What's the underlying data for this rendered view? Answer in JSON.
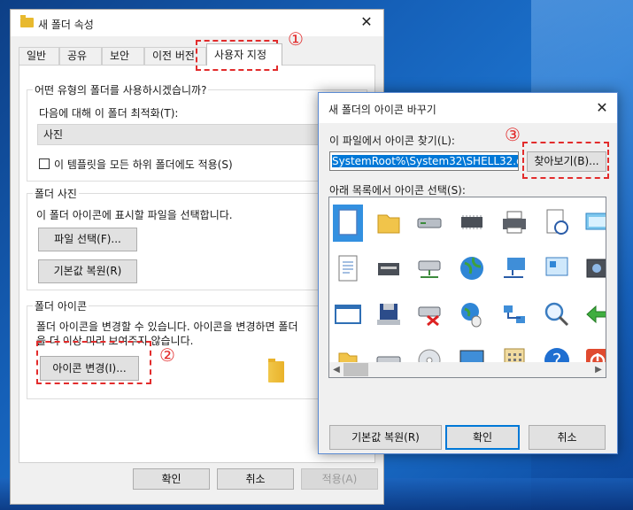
{
  "properties_window": {
    "title": "새 폴더 속성",
    "tabs": [
      "일반",
      "공유",
      "보안",
      "이전 버전",
      "사용자 지정"
    ],
    "active_tab": "사용자 지정",
    "optimize_group": {
      "title": "어떤 유형의 폴더를 사용하시겠습니까?",
      "optimize_label": "다음에 대해 이 폴더 최적화(T):",
      "optimize_value": "사진",
      "apply_subfolders_label": "이 템플릿을 모든 하위 폴더에도 적용(S)",
      "apply_subfolders_checked": false
    },
    "folder_picture_group": {
      "title": "폴더 사진",
      "description": "이 폴더 아이콘에 표시할 파일을 선택합니다.",
      "choose_file_label": "파일 선택(F)...",
      "restore_default_label": "기본값 복원(R)"
    },
    "folder_icon_group": {
      "title": "폴더 아이콘",
      "description_line1": "폴더 아이콘을 변경할 수 있습니다. 아이콘을 변경하면 폴더",
      "description_line2": "을 더 이상 미리 보여주지 않습니다.",
      "change_icon_label": "아이콘 변경(I)..."
    },
    "ok_label": "확인",
    "cancel_label": "취소",
    "apply_label": "적용(A)",
    "close_glyph": "✕"
  },
  "change_icon_dialog": {
    "title": "새 폴더의 아이콘 바꾸기",
    "look_in_label": "이 파일에서 아이콘 찾기(L):",
    "path_value": "SystemRoot%\\System32\\SHELL32.dll",
    "browse_label": "찾아보기(B)...",
    "select_label": "아래 목록에서 아이콘 선택(S):",
    "restore_default_label": "기본값 복원(R)",
    "ok_label": "확인",
    "cancel_label": "취소",
    "close_glyph": "✕",
    "icons": [
      [
        "blank-document",
        "folder",
        "hard-drive",
        "chip",
        "printer",
        "clock-document",
        "window-network",
        "hand-share",
        "recycle-bin"
      ],
      [
        "text-document",
        "media-drive",
        "network-drive",
        "globe",
        "network-computer",
        "control-panel",
        "camera",
        "shortcut-arrow",
        "clipboard"
      ],
      [
        "app-window",
        "floppy-drive",
        "disconnected-drive",
        "earth-mouse",
        "network-connections",
        "search",
        "recycle-arrow",
        "disc-shortcut",
        "blue-square"
      ],
      [
        "folder-small",
        "drive",
        "cd-drive",
        "monitor",
        "keypad",
        "help",
        "power",
        "recycle-bin-empty",
        "fax"
      ]
    ],
    "selected_icon": "blank-document"
  },
  "annotations": {
    "step1": "①",
    "step2": "②",
    "step3": "③",
    "color": "#e22c2c"
  }
}
